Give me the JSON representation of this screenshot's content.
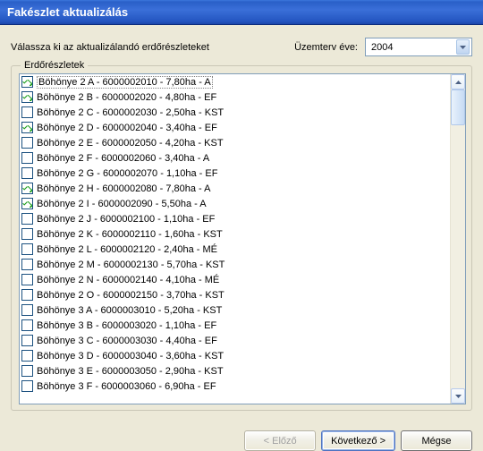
{
  "window": {
    "title": "Fakészlet aktualizálás"
  },
  "top": {
    "instruction": "Válassza ki az aktualizálandó erdőrészleteket",
    "plan_year_label": "Üzemterv éve:",
    "year": "2004"
  },
  "group": {
    "title": "Erdőrészletek"
  },
  "items": [
    {
      "checked": true,
      "label": "Böhönye 2 A - 6000002010 - 7,80ha - A"
    },
    {
      "checked": true,
      "label": "Böhönye 2 B - 6000002020 - 4,80ha - EF"
    },
    {
      "checked": false,
      "label": "Böhönye 2 C - 6000002030 - 2,50ha - KST"
    },
    {
      "checked": true,
      "label": "Böhönye 2 D - 6000002040 - 3,40ha - EF"
    },
    {
      "checked": false,
      "label": "Böhönye 2 E - 6000002050 - 4,20ha - KST"
    },
    {
      "checked": false,
      "label": "Böhönye 2 F - 6000002060 - 3,40ha - A"
    },
    {
      "checked": false,
      "label": "Böhönye 2 G - 6000002070 - 1,10ha - EF"
    },
    {
      "checked": true,
      "label": "Böhönye 2 H - 6000002080 - 7,80ha - A"
    },
    {
      "checked": true,
      "label": "Böhönye 2 I - 6000002090 - 5,50ha - A"
    },
    {
      "checked": false,
      "label": "Böhönye 2 J - 6000002100 - 1,10ha - EF"
    },
    {
      "checked": false,
      "label": "Böhönye 2 K - 6000002110 - 1,60ha - KST"
    },
    {
      "checked": false,
      "label": "Böhönye 2 L - 6000002120 - 2,40ha - MÉ"
    },
    {
      "checked": false,
      "label": "Böhönye 2 M - 6000002130 - 5,70ha - KST"
    },
    {
      "checked": false,
      "label": "Böhönye 2 N - 6000002140 - 4,10ha - MÉ"
    },
    {
      "checked": false,
      "label": "Böhönye 2 O - 6000002150 - 3,70ha - KST"
    },
    {
      "checked": false,
      "label": "Böhönye 3 A - 6000003010 - 5,20ha - KST"
    },
    {
      "checked": false,
      "label": "Böhönye 3 B - 6000003020 - 1,10ha - EF"
    },
    {
      "checked": false,
      "label": "Böhönye 3 C - 6000003030 - 4,40ha - EF"
    },
    {
      "checked": false,
      "label": "Böhönye 3 D - 6000003040 - 3,60ha - KST"
    },
    {
      "checked": false,
      "label": "Böhönye 3 E - 6000003050 - 2,90ha - KST"
    },
    {
      "checked": false,
      "label": "Böhönye 3 F - 6000003060 - 6,90ha - EF"
    }
  ],
  "buttons": {
    "back": "< Előző",
    "next": "Következő >",
    "cancel": "Mégse"
  }
}
